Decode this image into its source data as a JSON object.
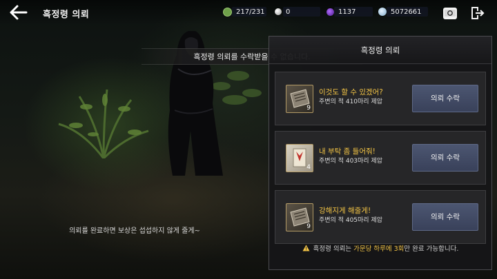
{
  "header": {
    "title": "흑정령 의뢰",
    "resources": {
      "stamina": "217/231",
      "pearl": "0",
      "gem": "1137",
      "silver": "5072661"
    }
  },
  "banner": "흑정령 의뢰를 수락받을 수 없습니다.",
  "dialog": "의뢰를 완료하면 보상은 섭섭하지 않게 줄게~",
  "panel": {
    "title": "흑정령 의뢰",
    "quests": [
      {
        "title": "이것도 할 수 있겠어?",
        "desc": "주변의 적 410마리 제압",
        "count": "9",
        "button": "의뢰 수락"
      },
      {
        "title": "내 부탁 좀 들어줘!",
        "desc": "주변의 적 403마리 제압",
        "count": "4",
        "button": "의뢰 수락"
      },
      {
        "title": "강해지게 해줄게!",
        "desc": "주변의 적 405마리 제압",
        "count": "9",
        "button": "의뢰 수락"
      }
    ],
    "notice": {
      "pre": "흑정령 의뢰는 ",
      "highlight": "가문당 하루에 3회",
      "post": "만 완료 가능합니다."
    }
  },
  "colors": {
    "highlight": "#f3c445",
    "button": "#434c66"
  }
}
